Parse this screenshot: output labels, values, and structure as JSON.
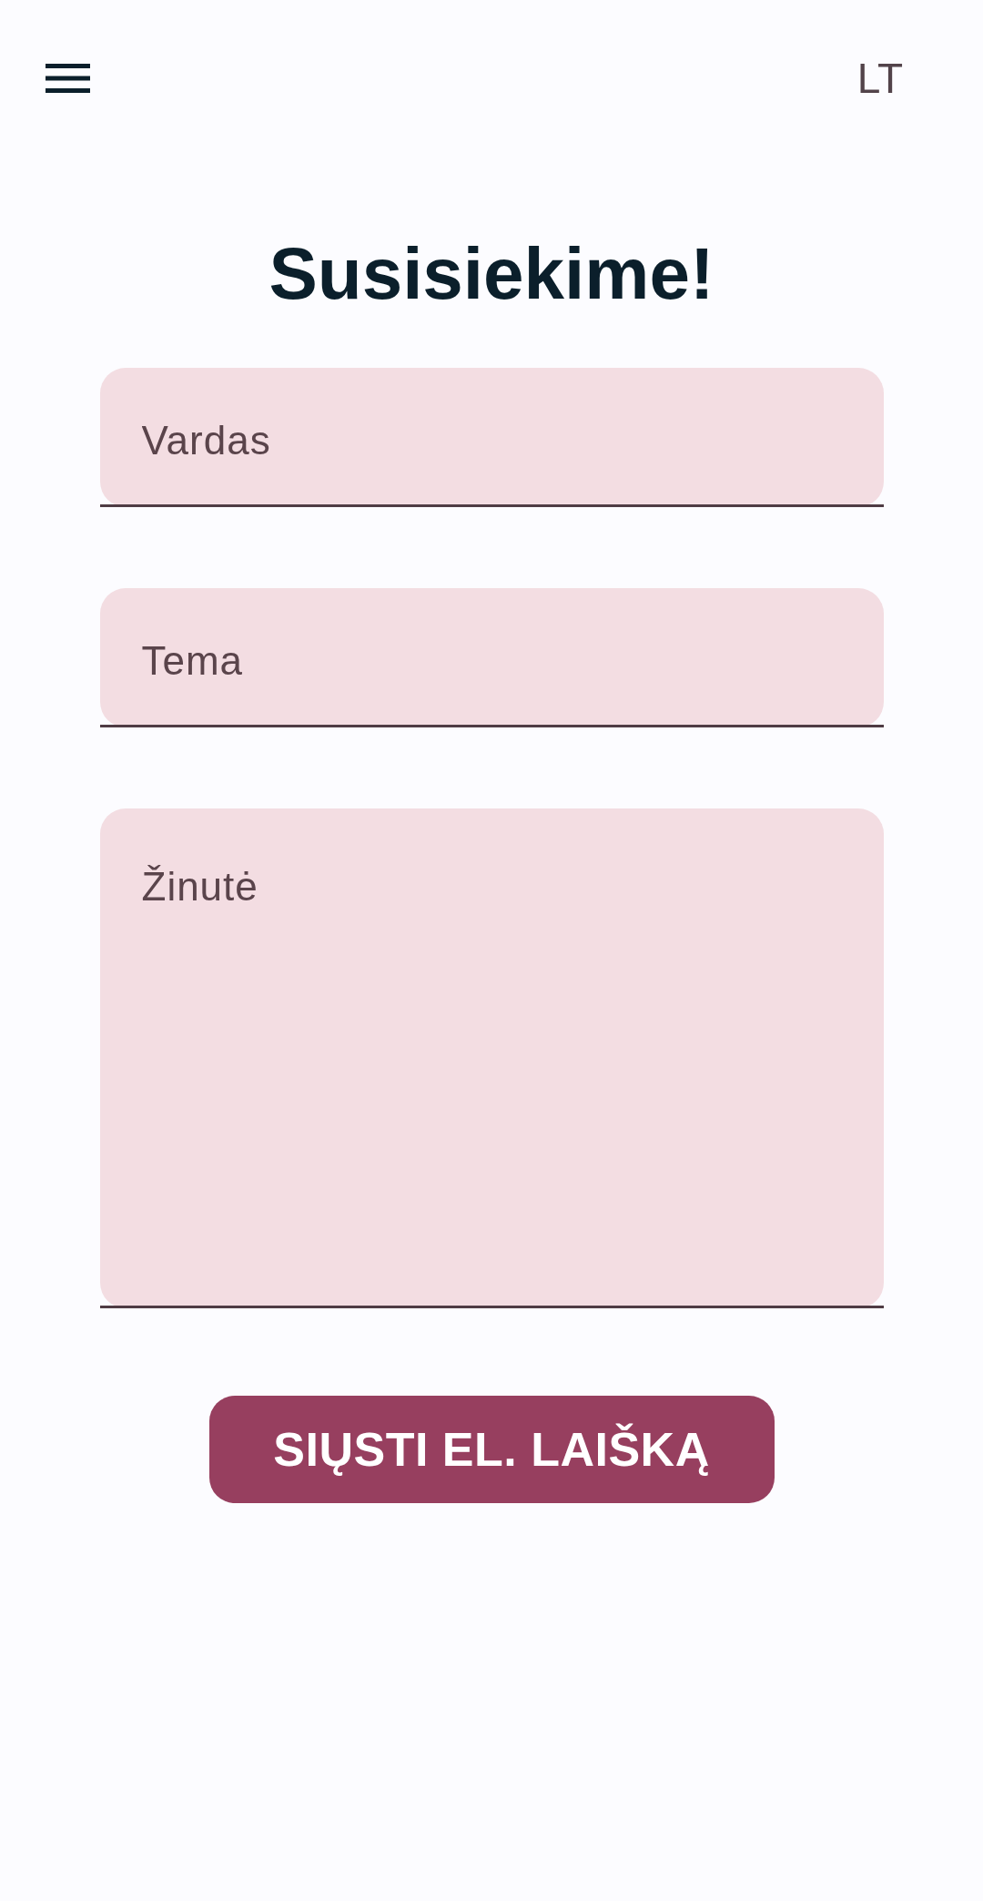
{
  "header": {
    "language": "LT"
  },
  "title": "Susisiekime!",
  "form": {
    "fields": [
      {
        "kind": "text",
        "placeholder": "Vardas"
      },
      {
        "kind": "text",
        "placeholder": "Tema"
      },
      {
        "kind": "textarea",
        "placeholder": "Žinutė"
      }
    ],
    "submit_button": "SIŲSTI EL. LAIŠKĄ"
  }
}
